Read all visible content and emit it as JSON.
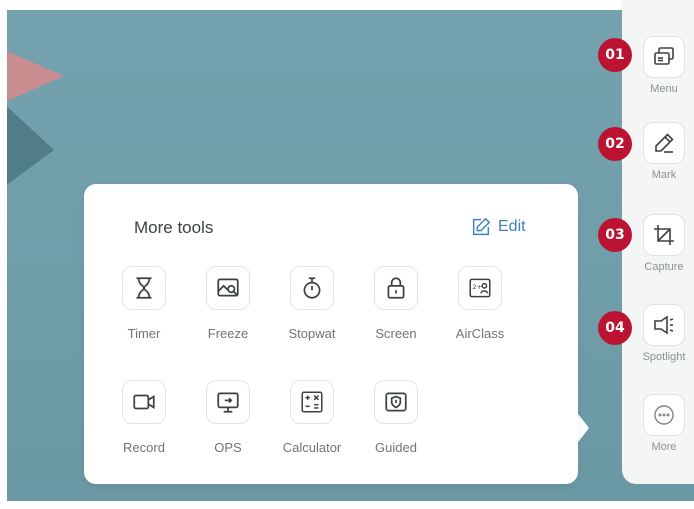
{
  "toolbar": {
    "items": [
      {
        "badge": "01",
        "label": "Menu",
        "icon": "window-switch-icon"
      },
      {
        "badge": "02",
        "label": "Mark",
        "icon": "pen-icon"
      },
      {
        "badge": "03",
        "label": "Capture",
        "icon": "crop-icon"
      },
      {
        "badge": "04",
        "label": "Spotlight",
        "icon": "spotlight-icon"
      },
      {
        "label": "More",
        "icon": "more-dots-icon"
      }
    ]
  },
  "more_tools": {
    "title": "More tools",
    "edit_label": "Edit",
    "tools": [
      {
        "label": "Timer",
        "icon": "hourglass-icon"
      },
      {
        "label": "Freeze",
        "icon": "freeze-image-icon"
      },
      {
        "label": "Stopwat",
        "icon": "stopwatch-icon"
      },
      {
        "label": "Screen",
        "icon": "lock-icon"
      },
      {
        "label": "AirClass",
        "icon": "airclass-icon"
      },
      {
        "label": "Record",
        "icon": "video-camera-icon"
      },
      {
        "label": "OPS",
        "icon": "monitor-icon"
      },
      {
        "label": "Calculator",
        "icon": "calculator-icon"
      },
      {
        "label": "Guided",
        "icon": "guided-shield-icon"
      }
    ]
  },
  "colors": {
    "badge": "#bd1333",
    "edit_accent": "#3f7fc4",
    "desktop": "#6f9ea9"
  }
}
